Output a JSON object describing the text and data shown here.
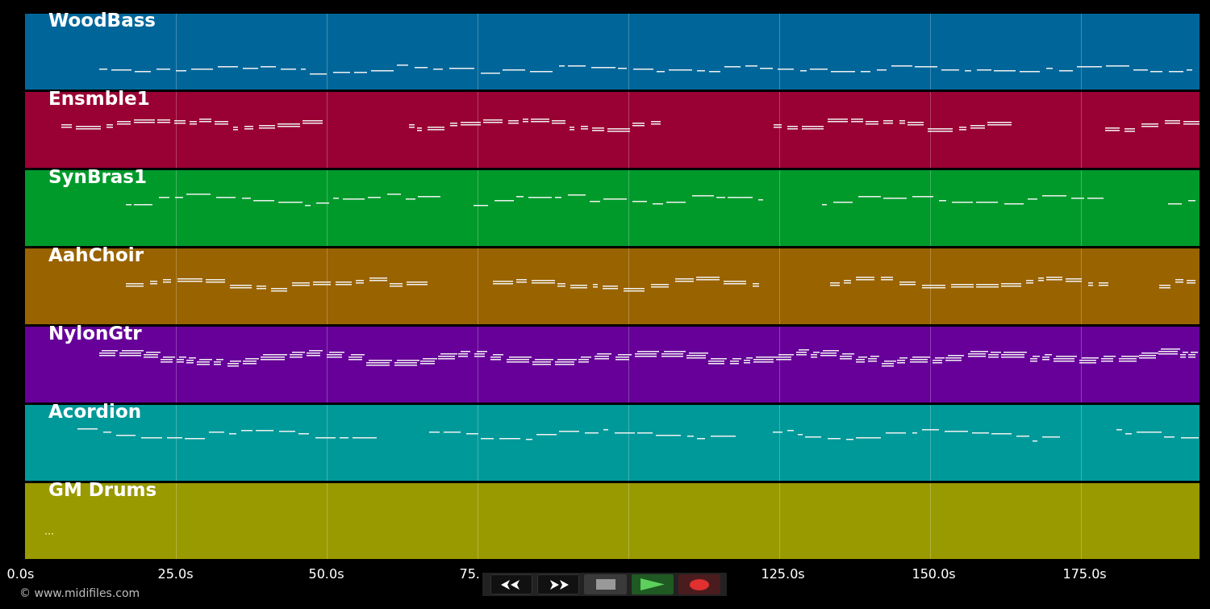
{
  "tracks": [
    {
      "name": "WoodBass",
      "color": "#00669a"
    },
    {
      "name": "Ensmble1",
      "color": "#990033"
    },
    {
      "name": "SynBras1",
      "color": "#009a2b"
    },
    {
      "name": "AahChoir",
      "color": "#996300"
    },
    {
      "name": "NylonGtr",
      "color": "#660099"
    },
    {
      "name": "Acordion",
      "color": "#009999"
    },
    {
      "name": "GM Drums",
      "color": "#999900"
    }
  ],
  "axis": {
    "ticks": [
      "0.0s",
      "25.0s",
      "50.0s",
      "75.",
      "125.0s",
      "150.0s",
      "175.0s"
    ]
  },
  "footer": "© www.midifiles.com",
  "transport": [
    {
      "kind": "rewind"
    },
    {
      "kind": "forward"
    },
    {
      "kind": "stop"
    },
    {
      "kind": "play"
    },
    {
      "kind": "record"
    }
  ]
}
